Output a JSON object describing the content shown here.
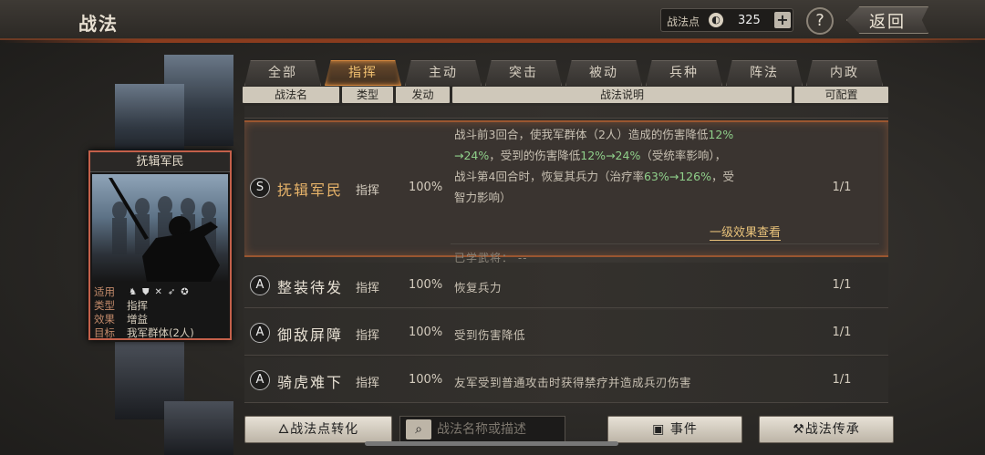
{
  "header": {
    "title": "战法",
    "points_label": "战法点",
    "points_value": "325",
    "plus": "+",
    "help": "?",
    "back_label": "返回"
  },
  "card": {
    "name": "抚辑军民",
    "rows": [
      {
        "k": "适用",
        "v": ""
      },
      {
        "k": "类型",
        "v": "指挥"
      },
      {
        "k": "效果",
        "v": "增益"
      },
      {
        "k": "目标",
        "v": "我军群体(2人)"
      }
    ],
    "unit_icons": [
      "horse-icon",
      "shield-icon",
      "cross-swords-icon",
      "spear-icon",
      "wheel-icon"
    ]
  },
  "tabs": [
    {
      "label": "全部",
      "active": false
    },
    {
      "label": "指挥",
      "active": true
    },
    {
      "label": "主动",
      "active": false
    },
    {
      "label": "突击",
      "active": false
    },
    {
      "label": "被动",
      "active": false
    },
    {
      "label": "兵种",
      "active": false
    },
    {
      "label": "阵法",
      "active": false
    },
    {
      "label": "内政",
      "active": false
    }
  ],
  "columns": {
    "name": "战法名",
    "type": "类型",
    "rate": "发动",
    "desc": "战法说明",
    "config": "可配置"
  },
  "selected": {
    "grade": "S",
    "name": "抚辑军民",
    "type": "指挥",
    "rate": "100%",
    "config": "1/1",
    "desc_1": "战斗前3回合，使我军群体（2人）造成的伤害降低",
    "desc_1_val": "12%",
    "desc_2_arrow": "→24%",
    "desc_2": "，受到的伤害降低",
    "desc_2_val": "12%→24%",
    "desc_2_tail": "（受统率影响），",
    "desc_3": "战斗第4回合时，恢复其兵力（治疗率",
    "desc_3_val": "63%→126%",
    "desc_3_tail": "，受",
    "desc_4": "智力影响）",
    "level_link": "一级效果查看",
    "learned": "已学武将： --"
  },
  "rows": [
    {
      "grade": "A",
      "name": "整装待发",
      "type": "指挥",
      "rate": "100%",
      "desc": "恢复兵力",
      "config": "1/1"
    },
    {
      "grade": "A",
      "name": "御敌屏障",
      "type": "指挥",
      "rate": "100%",
      "desc": "受到伤害降低",
      "config": "1/1"
    },
    {
      "grade": "A",
      "name": "骑虎难下",
      "type": "指挥",
      "rate": "100%",
      "desc": "友军受到普通攻击时获得禁疗并造成兵刃伤害",
      "config": "1/1"
    }
  ],
  "bottom": {
    "convert": "战法点转化",
    "search_placeholder": "战法名称或描述",
    "event": "事件",
    "inherit": "战法传承"
  }
}
